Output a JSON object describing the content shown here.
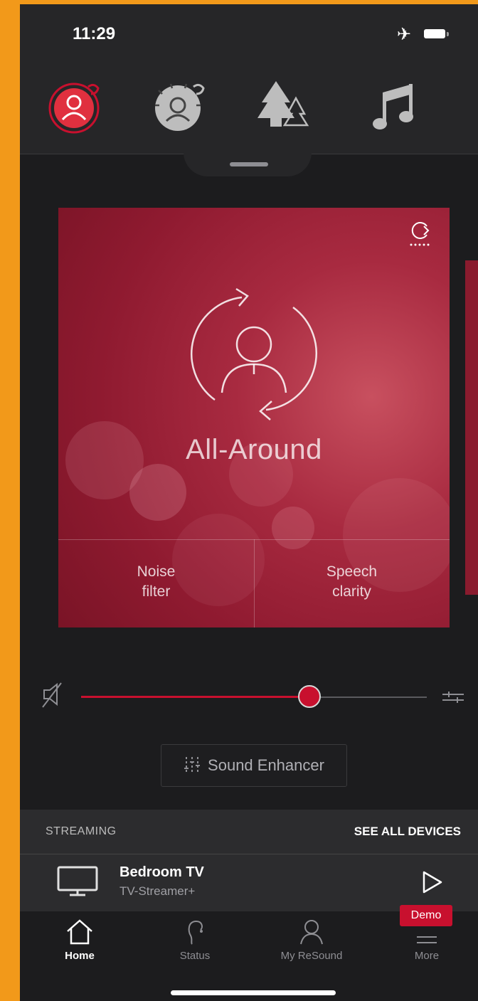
{
  "status_bar": {
    "time": "11:29"
  },
  "programs": [
    {
      "icon": "all-around-program-icon",
      "selected": true
    },
    {
      "icon": "restaurant-program-icon",
      "selected": false
    },
    {
      "icon": "outdoor-program-icon",
      "selected": false
    },
    {
      "icon": "music-program-icon",
      "selected": false
    }
  ],
  "card": {
    "title": "All-Around",
    "options": [
      "Noise filter",
      "Speech clarity"
    ],
    "option_lines": [
      [
        "Noise",
        "filter"
      ],
      [
        "Speech",
        "clarity"
      ]
    ]
  },
  "volume": {
    "level": 0.66
  },
  "sound_enhancer": {
    "label": "Sound Enhancer"
  },
  "streaming": {
    "header": "STREAMING",
    "see_all": "SEE ALL DEVICES",
    "device_name": "Bedroom TV",
    "device_type": "TV-Streamer+"
  },
  "tabbar": {
    "tabs": [
      "Home",
      "Status",
      "My ReSound",
      "More"
    ],
    "demo_badge": "Demo"
  },
  "colors": {
    "accent": "#c8102e",
    "background": "#1c1c1e",
    "frame": "#f2991a"
  }
}
